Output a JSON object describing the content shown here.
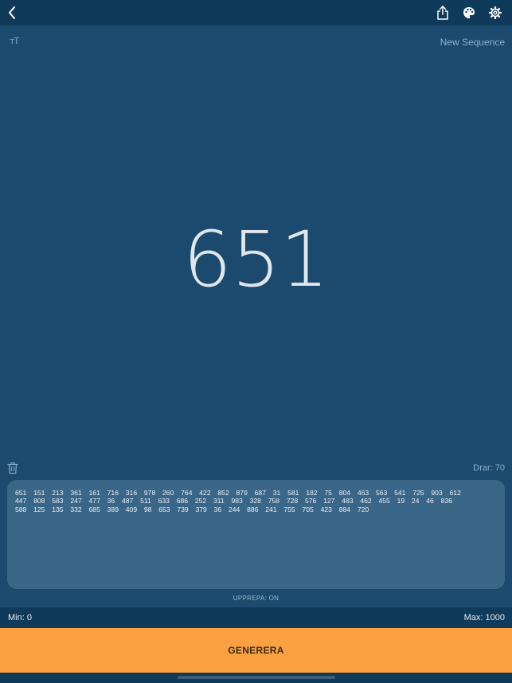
{
  "toolbar": {
    "back_icon": "chevron-left-icon",
    "share_icon": "share-icon",
    "palette_icon": "palette-icon",
    "settings_icon": "gear-icon"
  },
  "controls": {
    "font_size_glyph": "тT",
    "new_sequence_label": "New Sequence"
  },
  "result": {
    "current_number": "651"
  },
  "history_header": {
    "trash_icon": "trash-icon",
    "draw_count": "Drar: 70"
  },
  "history": {
    "lines": [
      "651 151 213 361 161 716 316 978 260 764 422 852 879 687 31 581 182 75 804 463 563 541 725 903 612",
      "447 808 583 247 477 36 487 511 633 686 252 311 983 328 758 728 576 127 483 462 455 19 24 46 836",
      "588 125 135 332 685 389 409 98 653 739 379 36 244 886 241 755 705 423 884 720"
    ]
  },
  "repeat_status": "UPPREPA: ON",
  "range": {
    "min_label": "Min: 0",
    "max_label": "Max: 1000"
  },
  "generate_button": {
    "label": "GENERERA"
  },
  "colors": {
    "background": "#1b4a6e",
    "bars": "#0f3a5a",
    "history_panel": "#3a6688",
    "accent_button": "#fba141"
  }
}
